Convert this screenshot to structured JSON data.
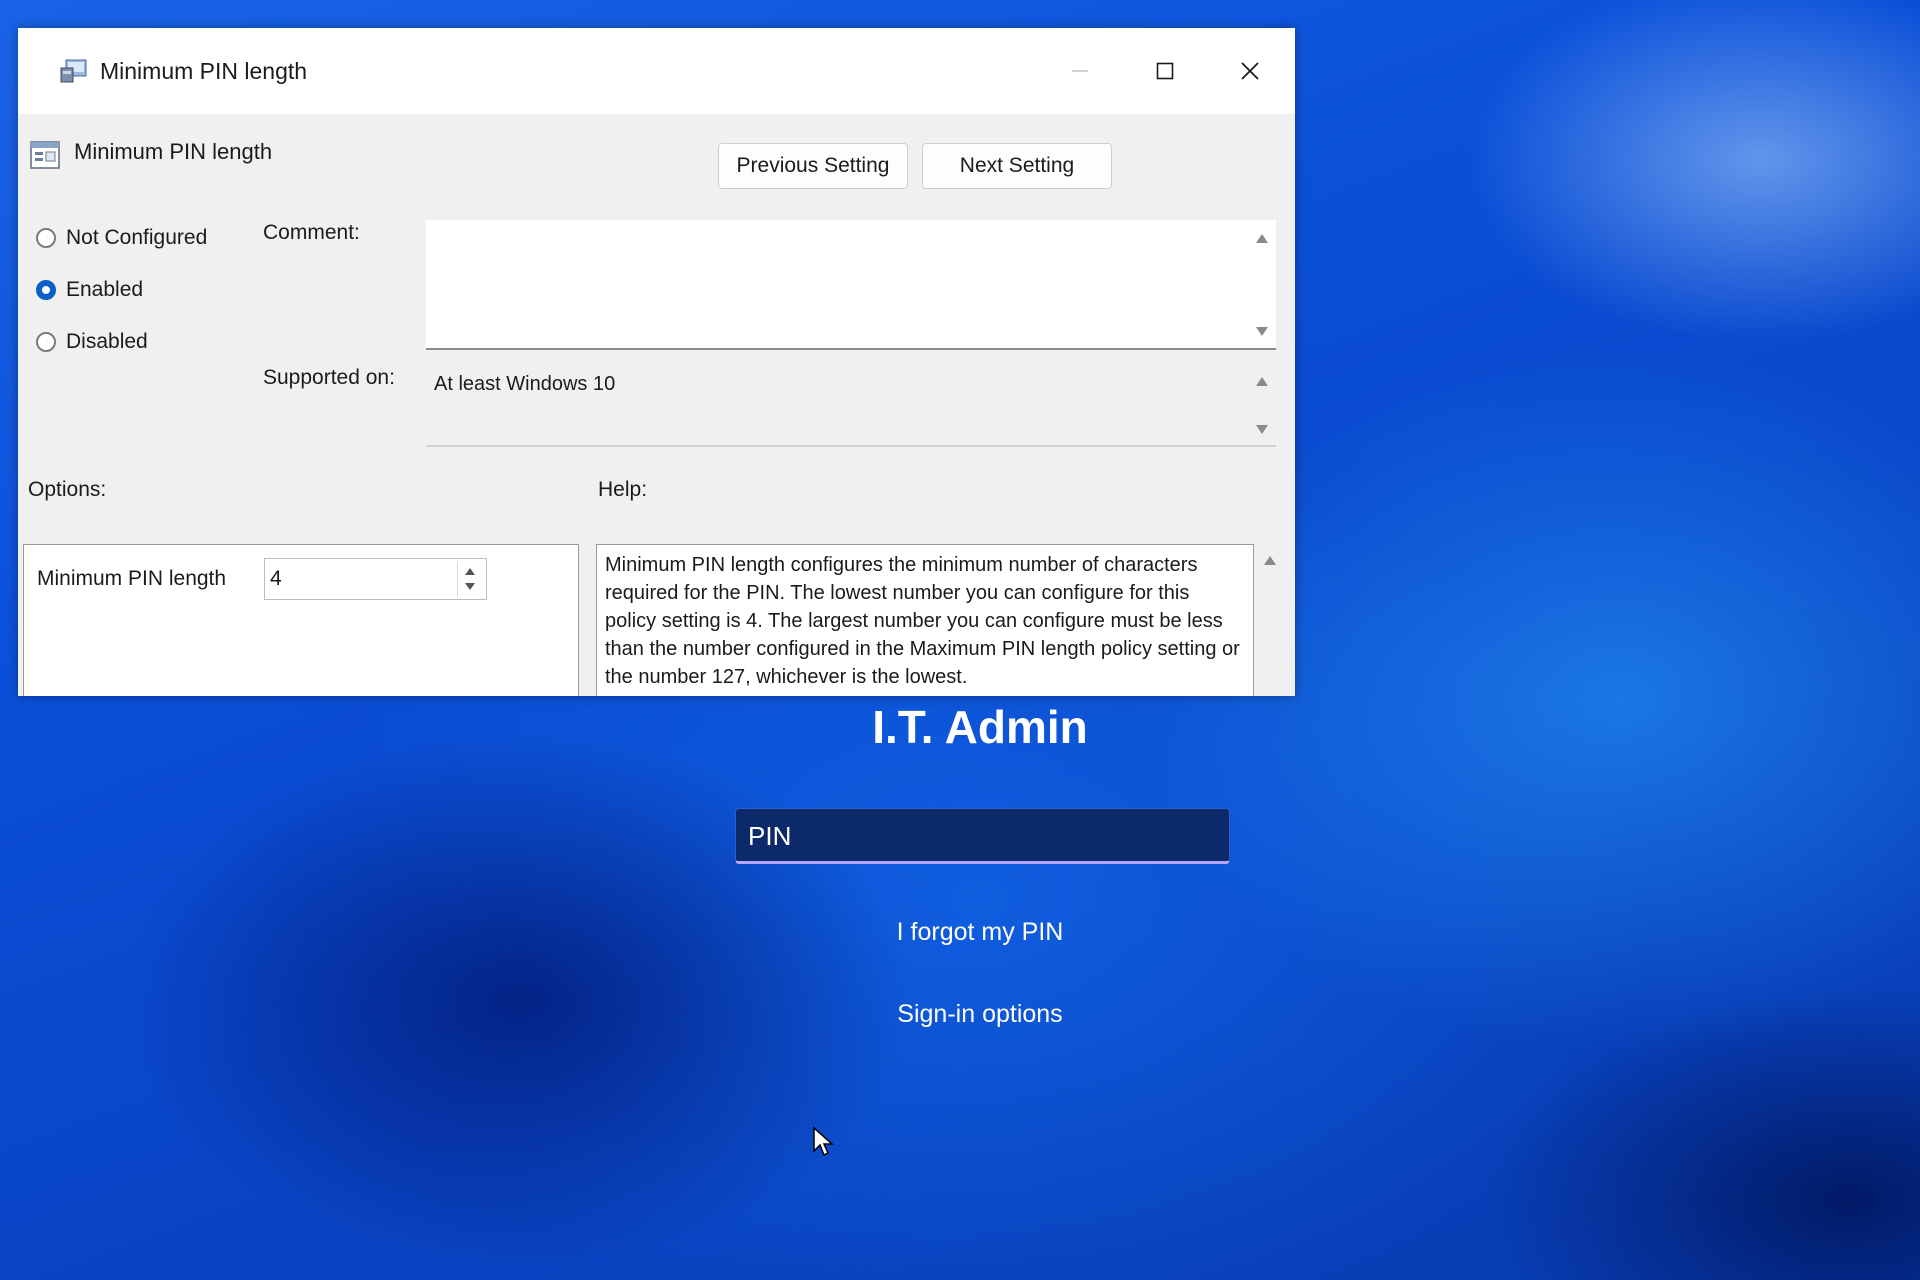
{
  "window": {
    "title": "Minimum PIN length",
    "minimize_glyph": "—",
    "maximize_glyph": "☐",
    "close_glyph": "✕"
  },
  "policy": {
    "name": "Minimum PIN length",
    "previous_label": "Previous Setting",
    "next_label": "Next Setting"
  },
  "state": {
    "options": [
      {
        "label": "Not Configured",
        "checked": false
      },
      {
        "label": "Enabled",
        "checked": true
      },
      {
        "label": "Disabled",
        "checked": false
      }
    ]
  },
  "comment": {
    "label": "Comment:",
    "value": ""
  },
  "supported": {
    "label": "Supported on:",
    "value": "At least Windows 10"
  },
  "options_panel": {
    "label": "Options:",
    "field_label": "Minimum PIN length",
    "field_value": "4"
  },
  "help_panel": {
    "label": "Help:",
    "text": "Minimum PIN length configures the minimum number of characters required for the PIN.  The lowest number you can configure for this policy setting is 4.  The largest number you can configure must be less than the number configured in the Maximum PIN length policy setting or the number 127, whichever is the lowest."
  },
  "lockscreen": {
    "user_name": "I.T. Admin",
    "pin_placeholder": "PIN",
    "forgot_pin": "I forgot my PIN",
    "signin_options": "Sign-in options"
  },
  "colors": {
    "accent": "#0a5fc8",
    "desktop_blue": "#0b4fd8",
    "pin_box": "#0c2a6a"
  }
}
